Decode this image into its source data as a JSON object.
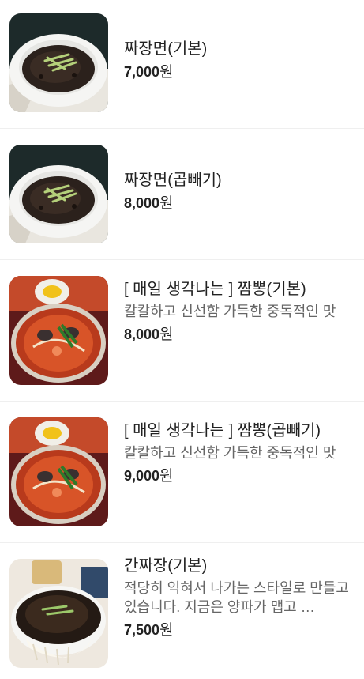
{
  "items": [
    {
      "name": "짜장면(기본)",
      "desc": "",
      "price": "7,000",
      "currency": "원",
      "image": "jjajangmyeon-icon"
    },
    {
      "name": "짜장면(곱빼기)",
      "desc": "",
      "price": "8,000",
      "currency": "원",
      "image": "jjajangmyeon-icon"
    },
    {
      "name": "[ 매일 생각나는 ] 짬뽕(기본)",
      "desc": "칼칼하고 신선함 가득한 중독적인 맛",
      "price": "8,000",
      "currency": "원",
      "image": "jjamppong-icon"
    },
    {
      "name": "[ 매일 생각나는 ] 짬뽕(곱빼기)",
      "desc": "칼칼하고 신선함 가득한 중독적인 맛",
      "price": "9,000",
      "currency": "원",
      "image": "jjamppong-icon"
    },
    {
      "name": "간짜장(기본)",
      "desc": "적당히 익혀서 나가는 스타일로 만들고 있습니다. 지금은 양파가 맵고 …",
      "price": "7,500",
      "currency": "원",
      "image": "ganjjajang-icon"
    }
  ]
}
